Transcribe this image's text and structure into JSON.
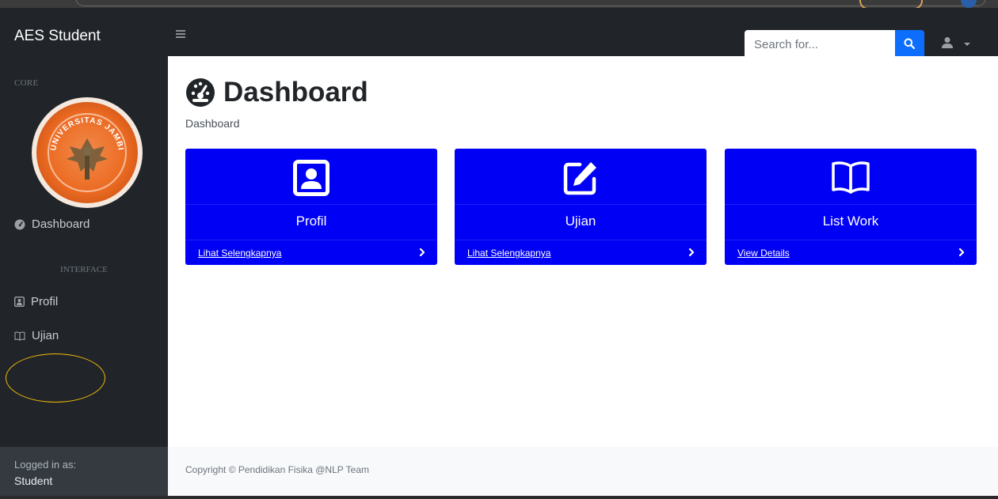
{
  "navbar": {
    "brand": "AES Student",
    "search_placeholder": "Search for..."
  },
  "sidebar": {
    "heading_core": "CORE",
    "logo_text": "UNIVERSITAS JAMBI",
    "items": [
      {
        "label": "Dashboard",
        "icon": "tachometer-icon"
      },
      {
        "label": "Profil",
        "icon": "id-badge-icon"
      },
      {
        "label": "Ujian",
        "icon": "book-icon"
      }
    ],
    "heading_interface": "INTERFACE",
    "footer": {
      "label": "Logged in as:",
      "user": "Student"
    }
  },
  "main": {
    "title": "Dashboard",
    "breadcrumb": "Dashboard",
    "cards": [
      {
        "title": "Profil",
        "link": "Lihat Selengkapnya",
        "icon": "user-portrait-icon"
      },
      {
        "title": "Ujian",
        "link": "Lihat Selengkapnya",
        "icon": "edit-icon"
      },
      {
        "title": "List Work",
        "link": "View Details",
        "icon": "open-book-icon"
      }
    ],
    "footer": "Copyright © Pendidikan Fisika @NLP Team"
  },
  "colors": {
    "navbar_bg": "#212529",
    "card_bg": "#0000f5",
    "search_button": "#0d6efd",
    "annotation": "#f2b90a"
  }
}
